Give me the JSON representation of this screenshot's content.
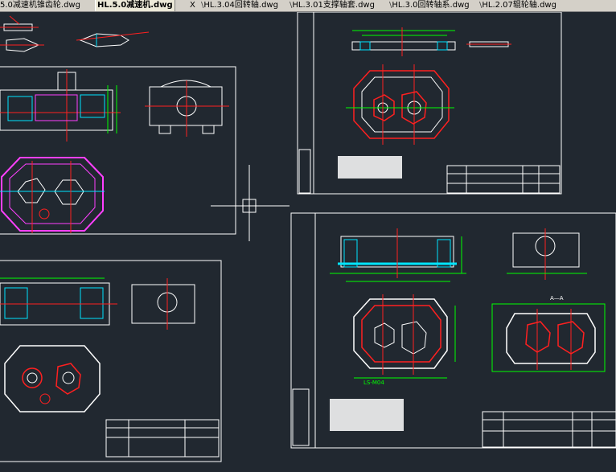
{
  "tabs": [
    {
      "label": "5.0减速机锥齿轮.dwg",
      "active": false
    },
    {
      "label": "HL.5.0减速机.dwg",
      "active": true
    },
    {
      "label": "HL.3.04回转轴.dwg",
      "active": false
    },
    {
      "label": "HL.3.01支撑轴套.dwg",
      "active": false
    },
    {
      "label": "HL.3.0回转轴系.dwg",
      "active": false
    },
    {
      "label": "HL.2.07辊轮轴.dwg",
      "active": false
    }
  ],
  "close_glyph": "X",
  "drawing": {
    "background": "#212830",
    "colors": {
      "frame": "#ffffff",
      "dimension": "#00ff00",
      "center": "#ff2020",
      "outline": "#ffffff",
      "hidden": "#ff40ff",
      "cyan": "#00e5ff",
      "yellow": "#ffff00",
      "blue": "#4060ff"
    },
    "annotation_a": "A—A",
    "annotation_label": "LS-M04"
  }
}
